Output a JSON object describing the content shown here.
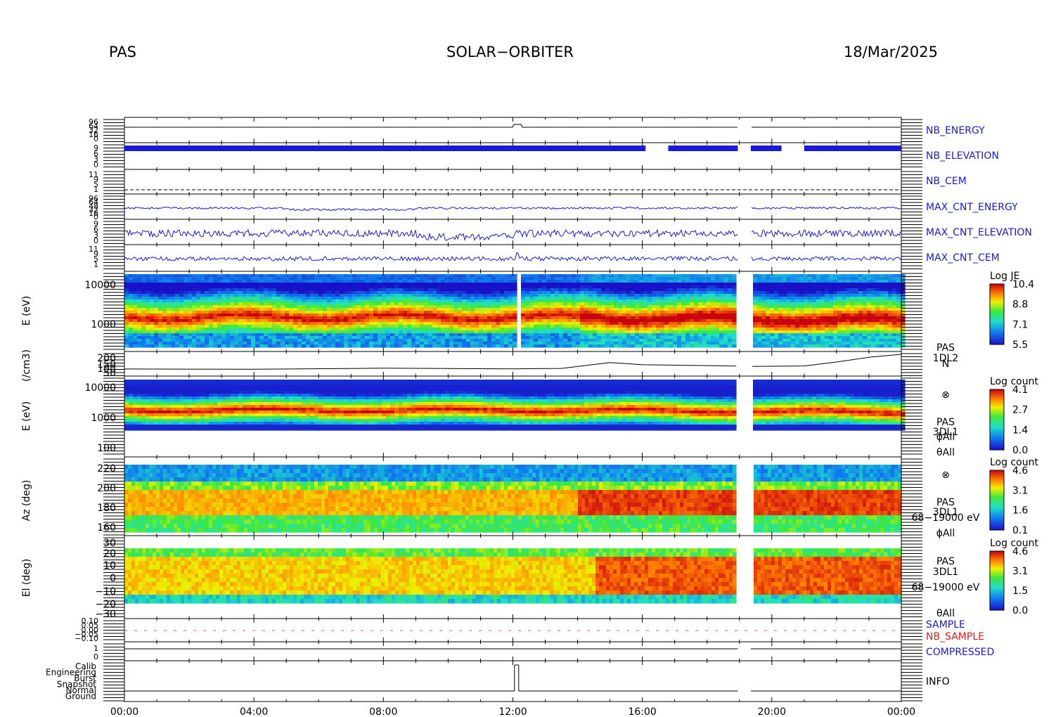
{
  "header": {
    "left": "PAS",
    "center": "SOLAR−ORBITER",
    "right": "18/Mar/2025"
  },
  "chart_data": {
    "type": "heatmap",
    "x_axis": {
      "range": [
        "00:00",
        "24:00"
      ],
      "tick_labels": [
        "00:00",
        "04:00",
        "08:00",
        "12:00",
        "16:00",
        "20:00",
        "00:00"
      ],
      "tick_hours": [
        0,
        4,
        8,
        12,
        16,
        20,
        24
      ]
    },
    "data_gap_hours": [
      18.95,
      19.35
    ],
    "panels": [
      {
        "id": "nb_energy",
        "kind": "line",
        "label": "NB_ENERGY",
        "label_color": "#1a1ad6",
        "left_ticks": [
          "96",
          "64",
          "32",
          "16",
          "0"
        ],
        "description": "step from 0 to higher value at ~12:00"
      },
      {
        "id": "nb_elevation",
        "kind": "strip",
        "label": "NB_ELEVATION",
        "label_color": "#1a1ad6",
        "left_ticks": [
          "9",
          "6",
          "3",
          "0"
        ]
      },
      {
        "id": "nb_cem",
        "kind": "line",
        "label": "NB_CEM",
        "label_color": "#1a1ad6",
        "left_ticks": [
          "11",
          "9",
          "5",
          "1"
        ]
      },
      {
        "id": "max_cnt_energy",
        "kind": "line",
        "label": "MAX_CNT_ENERGY",
        "label_color": "#1a1ad6",
        "left_ticks": [
          "96",
          "64",
          "48",
          "32",
          "16",
          "0"
        ]
      },
      {
        "id": "max_cnt_elevation",
        "kind": "line",
        "label": "MAX_CNT_ELEVATION",
        "label_color": "#1a1ad6",
        "left_ticks": [
          "9",
          "6",
          "3",
          "0"
        ]
      },
      {
        "id": "max_cnt_cem",
        "kind": "line",
        "label": "MAX_CNT_CEM",
        "label_color": "#1a1ad6",
        "left_ticks": [
          "11",
          "9",
          "5",
          "1"
        ]
      },
      {
        "id": "spec_je",
        "kind": "heatmap",
        "ylabel": "E (eV)",
        "yscale": "log",
        "y_ticks": [
          "10000",
          "1000"
        ],
        "ylim": [
          300,
          20000
        ],
        "colorbar": {
          "title": "Log JE",
          "labels": [
            "10.4",
            "8.8",
            "7.1",
            "5.5"
          ],
          "range": [
            5.5,
            10.4
          ]
        },
        "peak_energy_ev": 1700
      },
      {
        "id": "density",
        "kind": "line",
        "ylabel": "(/cm3)",
        "y_ticks": [
          "200",
          "150",
          "100",
          "50"
        ],
        "side_labels": [
          "PAS",
          "1DL2",
          "N"
        ],
        "series": [
          {
            "x": [
              0,
              4,
              8,
              12,
              13.5,
              15,
              16,
              18.9,
              19.4,
              21,
              22,
              23,
              24
            ],
            "y": [
              55,
              60,
              65,
              70,
              75,
              130,
              110,
              95,
              90,
              95,
              140,
              185,
              225
            ]
          }
        ]
      },
      {
        "id": "spec_count_e",
        "kind": "heatmap",
        "ylabel": "E (eV)",
        "yscale": "log",
        "y_ticks": [
          "10000",
          "1000",
          "100"
        ],
        "ylim": [
          60,
          15000
        ],
        "colorbar": {
          "title": "Log count",
          "labels": [
            "4.1",
            "2.7",
            "1.4",
            "0.0"
          ],
          "range": [
            0.0,
            4.1
          ]
        },
        "side_labels": [
          "⊗",
          "PAS",
          "3DL1",
          "ϕAll",
          "θAll"
        ]
      },
      {
        "id": "spec_az",
        "kind": "heatmap",
        "ylabel": "Az (deg)",
        "y_ticks": [
          "220",
          "200",
          "180",
          "160"
        ],
        "ylim": [
          154,
          226
        ],
        "colorbar": {
          "title": "Log count",
          "labels": [
            "4.6",
            "3.1",
            "1.6",
            "0.1"
          ],
          "range": [
            0.1,
            4.6
          ]
        },
        "side_labels": [
          "⊗",
          "PAS",
          "3DL1",
          "68−19000 eV",
          "ϕAll"
        ]
      },
      {
        "id": "spec_el",
        "kind": "heatmap",
        "ylabel": "El (deg)",
        "y_ticks": [
          "30",
          "20",
          "10",
          "0",
          "−10",
          "−20",
          "−30"
        ],
        "ylim": [
          -30,
          30
        ],
        "colorbar": {
          "title": "Log count",
          "labels": [
            "4.6",
            "3.1",
            "1.5",
            "0.0"
          ],
          "range": [
            0.0,
            4.6
          ]
        },
        "side_labels": [
          "PAS",
          "3DL1",
          "68−19000 eV",
          "θAll"
        ]
      },
      {
        "id": "sample",
        "kind": "line",
        "labels": [
          "SAMPLE",
          "NB_SAMPLE"
        ],
        "label_colors": [
          "#1a1ad6",
          "#e01a1a"
        ],
        "left_ticks": [
          "0.10",
          "0.05",
          "0.00",
          "−0.05",
          "−0.10"
        ]
      },
      {
        "id": "compressed",
        "kind": "line",
        "label": "COMPRESSED",
        "label_color": "#1a1ad6",
        "left_ticks": [
          "1",
          "0"
        ]
      },
      {
        "id": "info",
        "kind": "line",
        "label": "INFO",
        "label_color": "#000000",
        "left_ticks": [
          "Calib",
          "Engineering",
          "Burst",
          "Snapshot",
          "Normal",
          "Ground"
        ],
        "description": "Calib briefly at 12:00, Normal otherwise"
      }
    ]
  }
}
